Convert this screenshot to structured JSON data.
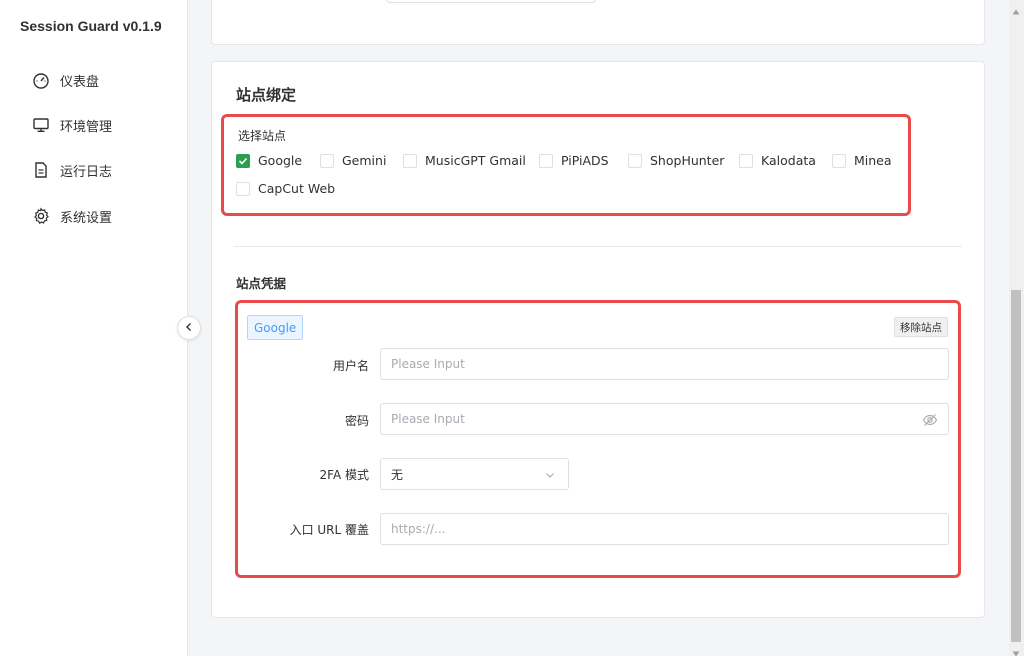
{
  "app": {
    "title": "Session Guard v0.1.9"
  },
  "sidebar": {
    "items": [
      {
        "label": "仪表盘",
        "icon": "dashboard-icon"
      },
      {
        "label": "环境管理",
        "icon": "monitor-icon"
      },
      {
        "label": "运行日志",
        "icon": "document-icon"
      },
      {
        "label": "系统设置",
        "icon": "gear-icon"
      }
    ]
  },
  "site_binding": {
    "title": "站点绑定",
    "select_label": "选择站点",
    "sites": [
      {
        "label": "Google",
        "checked": true
      },
      {
        "label": "Gemini",
        "checked": false
      },
      {
        "label": "MusicGPT Gmail",
        "checked": false
      },
      {
        "label": "PiPiADS",
        "checked": false
      },
      {
        "label": "ShopHunter",
        "checked": false
      },
      {
        "label": "Kalodata",
        "checked": false
      },
      {
        "label": "Minea",
        "checked": false
      },
      {
        "label": "CapCut Web",
        "checked": false
      }
    ]
  },
  "credentials": {
    "title": "站点凭据",
    "active_site": "Google",
    "remove_label": "移除站点",
    "username": {
      "label": "用户名",
      "placeholder": "Please Input"
    },
    "password": {
      "label": "密码",
      "placeholder": "Please Input"
    },
    "twofa": {
      "label": "2FA 模式",
      "value": "无"
    },
    "entry_url": {
      "label": "入口 URL 覆盖",
      "placeholder": "https://..."
    }
  },
  "colors": {
    "accent": "#2b9e4f",
    "highlight": "#e94b4b",
    "tag": "#409eff"
  }
}
